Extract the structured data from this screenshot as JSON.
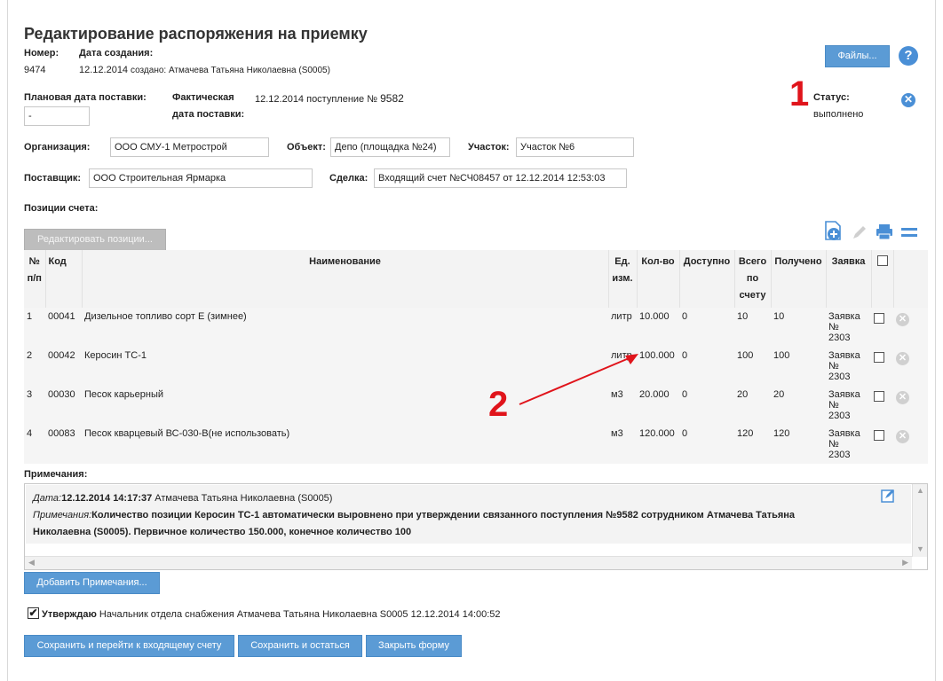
{
  "header": {
    "title": "Редактирование распоряжения на приемку",
    "number_label": "Номер:",
    "number_value": "9474",
    "created_label": "Дата создания:",
    "created_date": "12.12.2014",
    "created_by": "создано: Атмачева Татьяна Николаевна (S0005)",
    "files_button": "Файлы...",
    "help": "?"
  },
  "delivery": {
    "planned_label": "Плановая дата поставки:",
    "planned_value": "-",
    "actual_label_1": "Фактическая",
    "actual_label_2": "дата поставки:",
    "actual_value_prefix": "12.12.2014 поступление №",
    "actual_value_number": "9582"
  },
  "status": {
    "label": "Статус:",
    "value": "выполнено",
    "close_glyph": "✕"
  },
  "annotations": {
    "marker1": "1",
    "marker2": "2"
  },
  "org": {
    "org_label": "Организация:",
    "org_value": "ООО СМУ-1 Метрострой",
    "object_label": "Объект:",
    "object_value": "Депо (площадка №24)",
    "site_label": "Участок:",
    "site_value": "Участок №6",
    "supplier_label": "Поставщик:",
    "supplier_value": "ООО Строительная Ярмарка",
    "deal_label": "Сделка:",
    "deal_value": "Входящий счет №СЧ08457 от 12.12.2014 12:53:03"
  },
  "positions": {
    "label": "Позиции счета:",
    "edit_button": "Редактировать позиции...",
    "columns": {
      "num1": "№",
      "num2": "п/п",
      "code": "Код",
      "name": "Наименование",
      "unit1": "Ед.",
      "unit2": "изм.",
      "qty": "Кол-во",
      "avail": "Доступно",
      "total1": "Всего",
      "total2": "по",
      "total3": "счету",
      "received": "Получено",
      "request": "Заявка"
    },
    "rows": [
      {
        "n": "1",
        "code": "00041",
        "name": "Дизельное топливо сорт Е (зимнее)",
        "unit": "литр",
        "qty": "10.000",
        "avail": "0",
        "total": "10",
        "received": "10",
        "req1": "Заявка",
        "req2": "№",
        "req3": "2303"
      },
      {
        "n": "2",
        "code": "00042",
        "name": "Керосин ТС-1",
        "unit": "литр",
        "qty": "100.000",
        "avail": "0",
        "total": "100",
        "received": "100",
        "req1": "Заявка",
        "req2": "№",
        "req3": "2303"
      },
      {
        "n": "3",
        "code": "00030",
        "name": "Песок карьерный",
        "unit": "м3",
        "qty": "20.000",
        "avail": "0",
        "total": "20",
        "received": "20",
        "req1": "Заявка",
        "req2": "№",
        "req3": "2303"
      },
      {
        "n": "4",
        "code": "00083",
        "name": "Песок кварцевый ВС-030-В(не использовать)",
        "unit": "м3",
        "qty": "120.000",
        "avail": "0",
        "total": "120",
        "received": "120",
        "req1": "Заявка",
        "req2": "№",
        "req3": "2303"
      }
    ]
  },
  "notes": {
    "label": "Примечания:",
    "date_label": "Дата:",
    "date_value": "12.12.2014 14:17:37",
    "author": "Атмачева Татьяна Николаевна (S0005)",
    "note_label": "Примечания:",
    "note_text_1": "Количество позиции Керосин ТС-1 автоматически выровнено при утверждении связанного поступления №9582 сотрудником Атмачева Татьяна",
    "note_text_2": "Николаевна (S0005). Первичное количество 150.000, конечное количество 100",
    "add_button": "Добавить Примечания..."
  },
  "approval": {
    "label": "Утверждаю",
    "text": "Начальник отдела снабжения Атмачева Татьяна Николаевна S0005 12.12.2014 14:00:52",
    "check_glyph": "✔"
  },
  "footer": {
    "save_go": "Сохранить и перейти к входящему счету",
    "save_stay": "Сохранить и остаться",
    "close": "Закрыть форму"
  },
  "colors": {
    "accent": "#5b9bd5",
    "annotation": "#e0141b"
  }
}
